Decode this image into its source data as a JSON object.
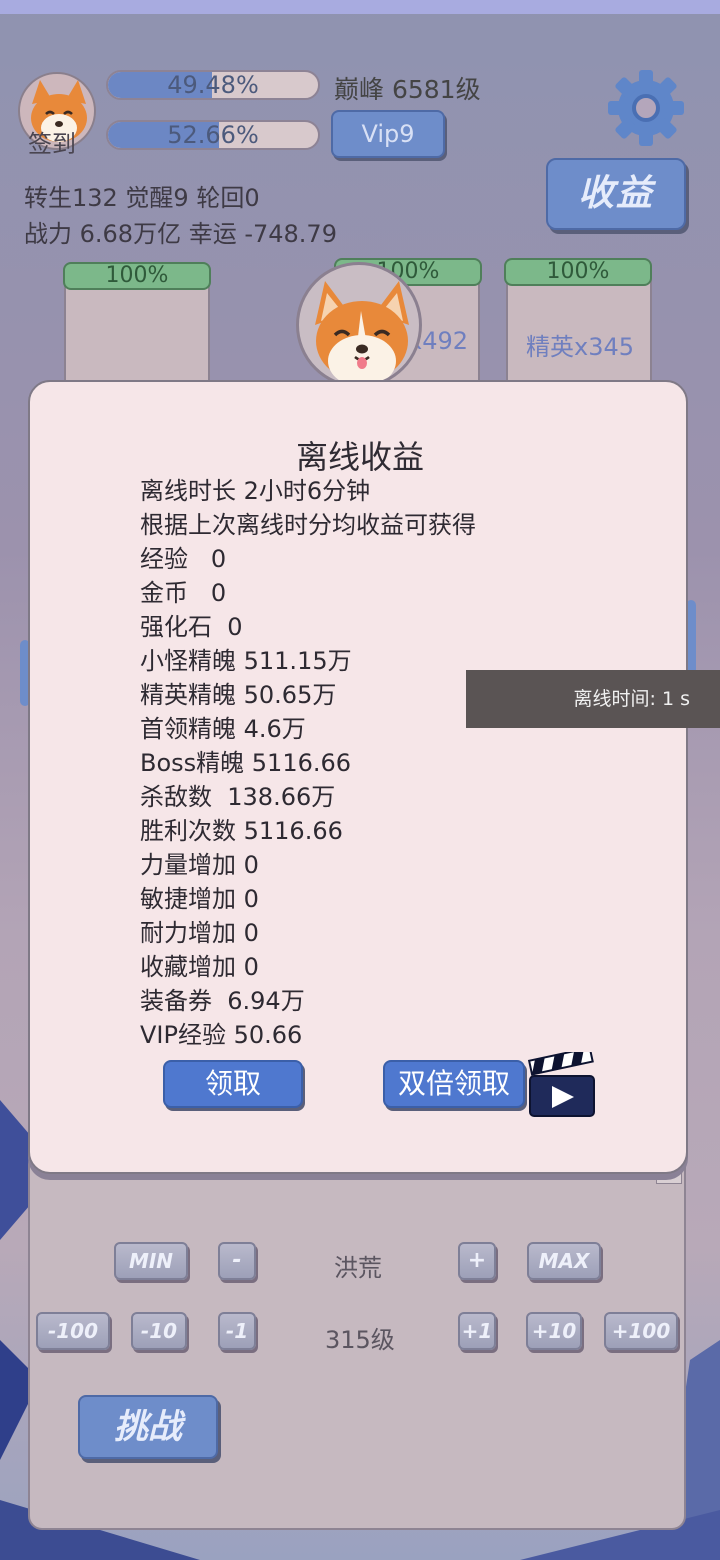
{
  "header": {
    "signin_label": "签到",
    "exp_bar": {
      "text": "49.48%",
      "fraction": 0.4948
    },
    "vip_bar": {
      "text": "52.66%",
      "fraction": 0.5266
    },
    "peak_level": "巅峰 6581级",
    "vip_button": "Vip9",
    "income_button": "收益",
    "stats_line1": "转生132 觉醒9 轮回0",
    "stats_line2": "战力 6.68万亿  幸运 -748.79"
  },
  "cards": [
    {
      "percent": "100%",
      "fraction": 1.0,
      "label": ""
    },
    {
      "percent": "100%",
      "fraction": 1.0,
      "label": "x492"
    },
    {
      "percent": "100%",
      "fraction": 1.0,
      "label": "精英x345"
    }
  ],
  "modal": {
    "title": "离线收益",
    "lines": [
      "离线时长 2小时6分钟",
      "根据上次离线时分均收益可获得",
      "经验   0",
      "金币   0",
      "强化石  0",
      "小怪精魄 511.15万",
      "精英精魄 50.65万",
      "首领精魄 4.6万",
      "Boss精魄 5116.66",
      "杀敌数  138.66万",
      "胜利次数 5116.66",
      "力量增加 0",
      "敏捷增加 0",
      "耐力增加 0",
      "收藏增加 0",
      "装备券  6.94万",
      "VIP经验 50.66"
    ],
    "claim_button": "领取",
    "double_claim_button": "双倍领取"
  },
  "toast": {
    "text": "离线时间: 1 s"
  },
  "lower_panel": {
    "min_label": "MIN",
    "minus_label": "-",
    "plus_label": "+",
    "max_label": "MAX",
    "area_name": "洪荒",
    "m100": "-100",
    "m10": "-10",
    "m1": "-1",
    "p1": "+1",
    "p10": "+10",
    "p100": "+100",
    "level": "315级",
    "challenge_button": "挑战"
  },
  "colors": {
    "accent_blue": "#4f78cf",
    "button_blue": "#6e8dca",
    "modal_bg": "#f6e6e8",
    "bar_green": "#7cb88a"
  },
  "icons": [
    "corgi-avatar-icon",
    "gear-icon",
    "corgi-badge-icon",
    "video-clapper-icon"
  ]
}
